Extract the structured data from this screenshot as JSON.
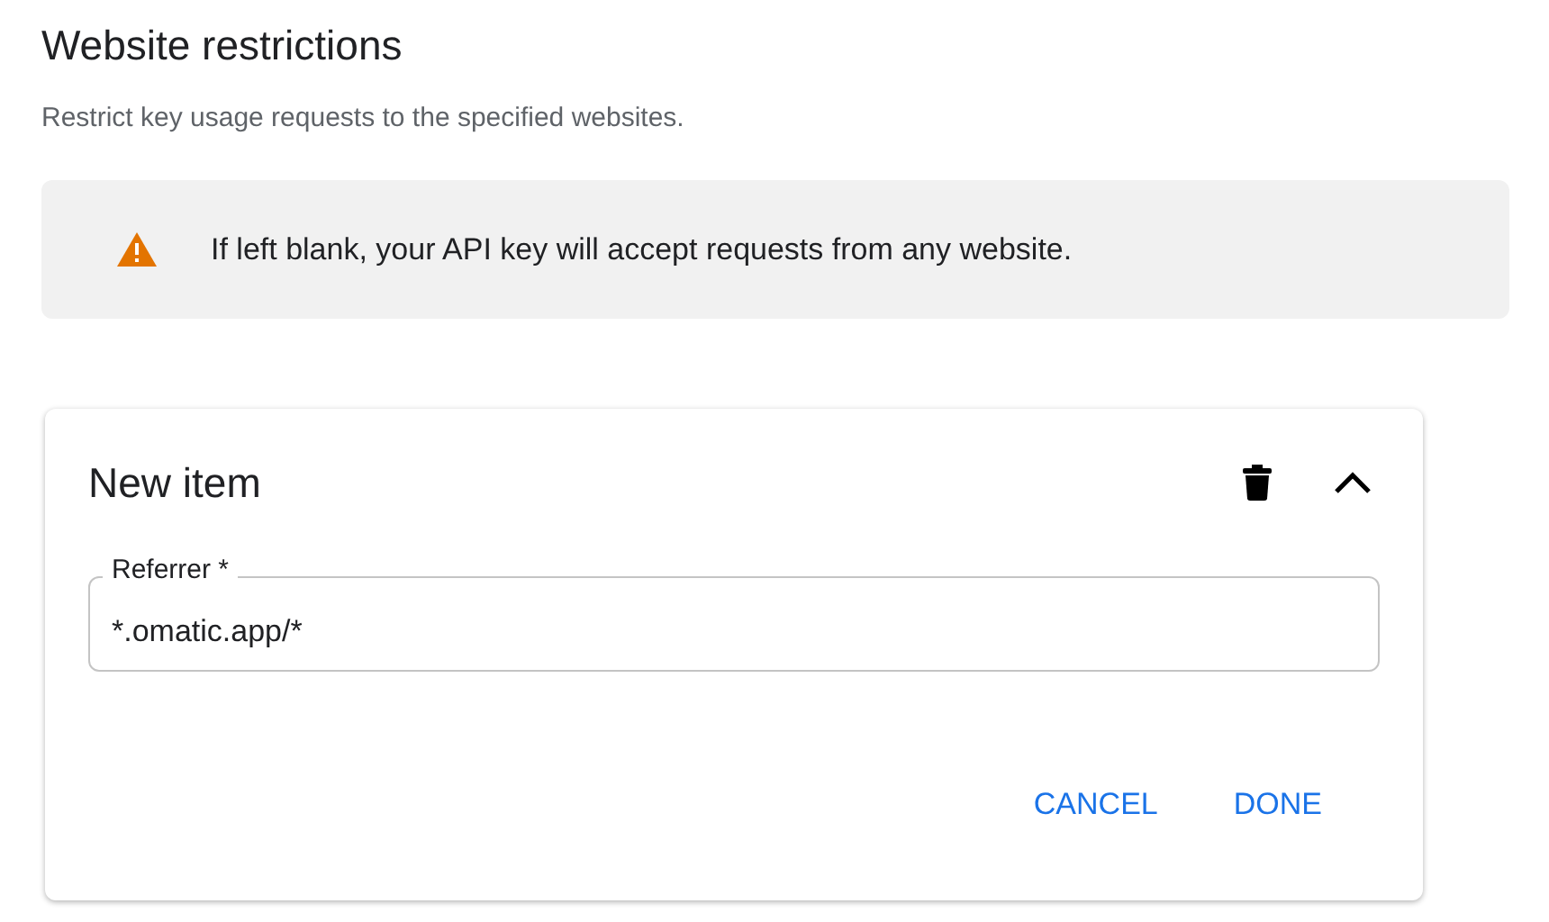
{
  "section": {
    "title": "Website restrictions",
    "description": "Restrict key usage requests to the specified websites."
  },
  "banner": {
    "kind": "warning",
    "text": "If left blank, your API key will accept requests from any website."
  },
  "item": {
    "title": "New item",
    "expanded": true,
    "field": {
      "label": "Referrer *",
      "value": "*.omatic.app/*"
    },
    "buttons": [
      "CANCEL",
      "DONE"
    ]
  }
}
